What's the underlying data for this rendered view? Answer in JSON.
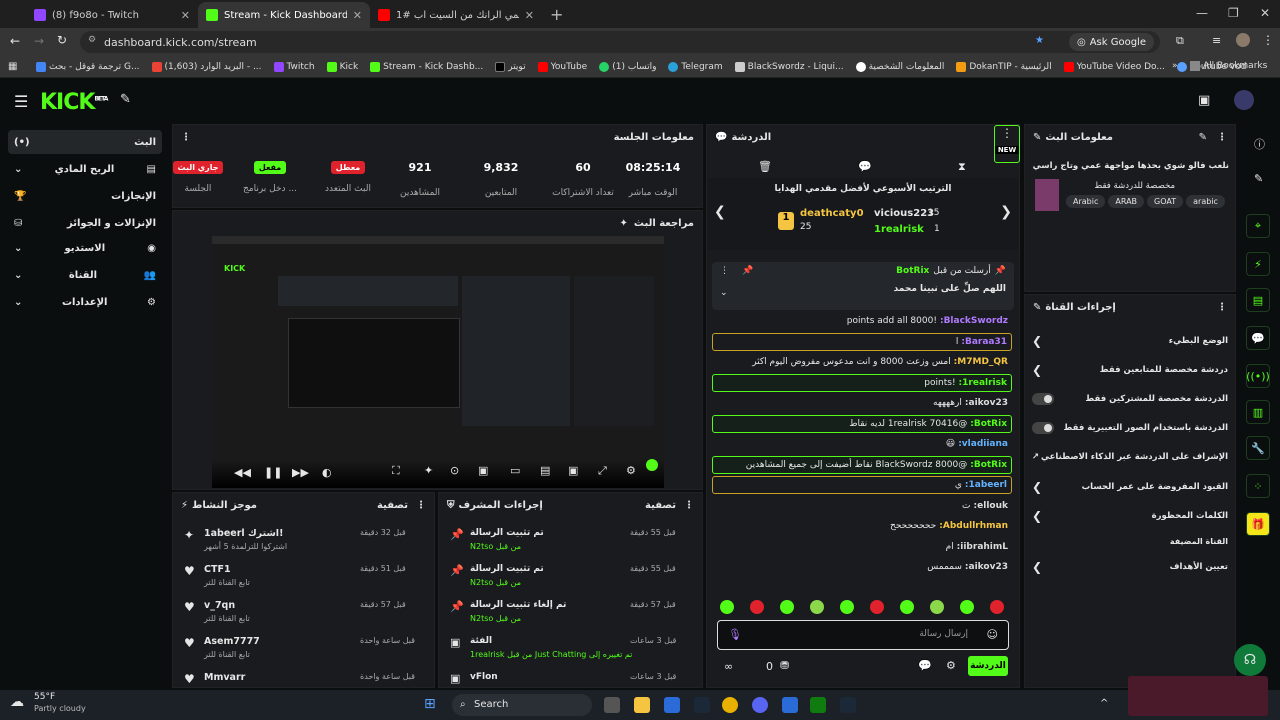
{
  "browser": {
    "tabs": [
      {
        "title": "(8) f9o8o - Twitch",
        "color": "#9146ff"
      },
      {
        "title": "Stream - Kick Dashboard",
        "color": "#53fc18"
      },
      {
        "title": "نحمي الرانك من السيت اب #1 🤣",
        "color": "#ff0000"
      }
    ],
    "url": "dashboard.kick.com/stream",
    "ask_google": "Ask Google",
    "bookmarks": [
      "ترجمة قوقل - بحث G...",
      "(1,603) البريد الوارد - ...",
      "Twitch",
      "Kick",
      "Stream - Kick Dashb...",
      "تويتر",
      "YouTube",
      "واتساب (1)",
      "Telegram",
      "BlackSwordz - Liqui...",
      "المعلومات الشخصية",
      "DokanTIP - الرئيسية",
      "YouTube Video Do...",
      "youtube vod"
    ],
    "all_bookmarks": "All Bookmarks"
  },
  "kick": {
    "logo": "KICK",
    "beta": "BETA",
    "sidebar": [
      {
        "label": "البث",
        "icon": "(•)"
      },
      {
        "label": "الربح المادي",
        "icon": "▤"
      },
      {
        "label": "الإنجازات",
        "icon": "🏆"
      },
      {
        "label": "الإنزالات و الجوائز",
        "icon": "⛁"
      },
      {
        "label": "الاستديو",
        "icon": "◉"
      },
      {
        "label": "القناة",
        "icon": "👥"
      },
      {
        "label": "الإعدادات",
        "icon": "⚙"
      }
    ],
    "session": {
      "title": "معلومات الجلسة",
      "stats": [
        {
          "label": "الوقت مباشر",
          "value": "08:25:14"
        },
        {
          "label": "تعداد الاشتراكات",
          "value": "60"
        },
        {
          "label": "المتابعين",
          "value": "9,832"
        },
        {
          "label": "المشاهدين",
          "value": "921"
        },
        {
          "label": "البث المتعدد",
          "badge": "معطل",
          "badge_color": "#e0222c"
        },
        {
          "label": "دخل برنامج ...",
          "badge": "مفعل",
          "badge_color": "#53fc18"
        },
        {
          "label": "الجلسة",
          "badge": "جاري البث",
          "badge_color": "#e0222c"
        }
      ]
    },
    "preview": {
      "title": "مراجعة البث"
    },
    "activity": {
      "title": "موجز النشاط",
      "filter": "تصفية",
      "items": [
        {
          "name": "1abeerl اشترك!",
          "sub": "اشتركوا للترلمدة 5 أشهر",
          "time": "قبل 32 دقيقة",
          "icon": "✦"
        },
        {
          "name": "CTF1",
          "sub": "تابع القناة للتر",
          "time": "قبل 51 دقيقة",
          "icon": "♥"
        },
        {
          "name": "v_7qn",
          "sub": "تابع القناة للتر",
          "time": "قبل 57 دقيقة",
          "icon": "♥"
        },
        {
          "name": "Asem7777",
          "sub": "تابع القناة للتر",
          "time": "قبل ساعة واحدة",
          "icon": "♥"
        },
        {
          "name": "Mmvarr",
          "sub": "",
          "time": "قبل ساعة واحدة",
          "icon": "♥"
        }
      ]
    },
    "modactions": {
      "title": "إجراءات المشرف",
      "filter": "تصفية",
      "items": [
        {
          "name": "تم تثبيت الرسالة",
          "sub": "من قبل N2tso",
          "time": "قبل 55 دقيقة",
          "icon": "📌"
        },
        {
          "name": "تم تثبيت الرسالة",
          "sub": "من قبل N2tso",
          "time": "قبل 55 دقيقة",
          "icon": "📌"
        },
        {
          "name": "تم إلغاء تثبيت الرسالة",
          "sub": "من قبل N2tso",
          "time": "قبل 57 دقيقة",
          "icon": "📌"
        },
        {
          "name": "الفئة",
          "sub": "تم تغييره إلى Just Chatting من قبل 1realrisk",
          "time": "قبل 3 ساعات",
          "icon": "▣"
        },
        {
          "name": "vFlon",
          "sub": "",
          "time": "قبل 3 ساعات",
          "icon": "▣"
        }
      ]
    },
    "chat": {
      "title": "الدردشة",
      "new_badge": "NEW",
      "leaderboard_title": "الترتيب الأسبوعي لأفضل مقدمي الهدايا",
      "leaders": [
        {
          "rank": "1",
          "name": "deathcaty0",
          "score": "25"
        },
        {
          "rank": "",
          "name": "vicious223",
          "score": "15"
        },
        {
          "rank": "",
          "name": "1realrisk",
          "score": "1"
        }
      ],
      "pinned_by": "أرسلت من قبل",
      "pinned_user": "BotRix",
      "pinned_text": "اللهم صلِّ على نبينا محمد",
      "messages": [
        {
          "user": "BlackSwordz:",
          "text": "!points add all 8000",
          "color": "#b07bff",
          "style": ""
        },
        {
          "user": "Baraa31:",
          "text": "ا",
          "color": "#b07bff",
          "style": "gold"
        },
        {
          "user": "M7MD_QR:",
          "text": "امس وزعت 8000 و انت مدعوس مفروض اليوم اكثر",
          "color": "#f5c542",
          "style": ""
        },
        {
          "user": "1realrisk:",
          "text": "!points",
          "color": "#53fc18",
          "style": "hl"
        },
        {
          "user": "aikov23:",
          "text": "ارههههه",
          "color": "#ddd",
          "style": ""
        },
        {
          "user": "BotRix:",
          "text": "@1realrisk 70416 لديه نقاط",
          "color": "#53fc18",
          "style": "hl"
        },
        {
          "user": "vladiiana:",
          "text": "😃",
          "color": "#63b3ff",
          "style": ""
        },
        {
          "user": "BotRix:",
          "text": "@BlackSwordz 8000 نقاط أضيفت إلى جميع المشاهدين",
          "color": "#53fc18",
          "style": "hl"
        },
        {
          "user": "1abeerl:",
          "text": "ي",
          "color": "#63b3ff",
          "style": "gold"
        },
        {
          "user": "ellouk:",
          "text": "ت",
          "color": "#ddd",
          "style": ""
        },
        {
          "user": "Abdullrhman:",
          "text": "حححححححح",
          "color": "#f5c542",
          "style": ""
        },
        {
          "user": "iibrahimL:",
          "text": "ام",
          "color": "#ddd",
          "style": ""
        },
        {
          "user": "aikov23:",
          "text": "سمممس",
          "color": "#ddd",
          "style": ""
        }
      ],
      "input_placeholder": "إرسال رسالة",
      "send_label": "الدردشة",
      "points": "0"
    },
    "stream_info": {
      "title": "معلومات البث",
      "stream_title": "نلعب فالو شوي بحذها مواجهة عمي وتاج راسي رادان",
      "category": "مخصصة للدردشة فقط",
      "tags": [
        "arabic",
        "GOAT",
        "ARAB",
        "Arabic"
      ]
    },
    "channel_actions": {
      "title": "إجراءات القناة",
      "items": [
        {
          "label": "الوضع البطيء",
          "control": "chevron"
        },
        {
          "label": "دردشة مخصصة للمتابعين فقط",
          "control": "chevron"
        },
        {
          "label": "الدردشة مخصصة للمشتركين فقط",
          "control": "toggle"
        },
        {
          "label": "الدردشة باستخدام الصور التعبيرية فقط",
          "control": "toggle"
        },
        {
          "label": "الإشراف على الدردشة عبر الذكاء الاصطناعي",
          "control": "link"
        },
        {
          "label": "القيود المفروضة على عمر الحساب",
          "control": "chevron"
        },
        {
          "label": "الكلمات المحظورة",
          "control": "chevron"
        },
        {
          "label": "القناة المضيفة",
          "control": "none"
        },
        {
          "label": "تعيين الأهداف",
          "control": "chevron"
        }
      ]
    }
  },
  "taskbar": {
    "weather_temp": "55°F",
    "weather_desc": "Partly cloudy",
    "search": "Search"
  },
  "colors": {
    "brand": "#53fc18",
    "bg": "#0b0e0f",
    "panel": "#191b1f",
    "live_red": "#e0222c"
  }
}
